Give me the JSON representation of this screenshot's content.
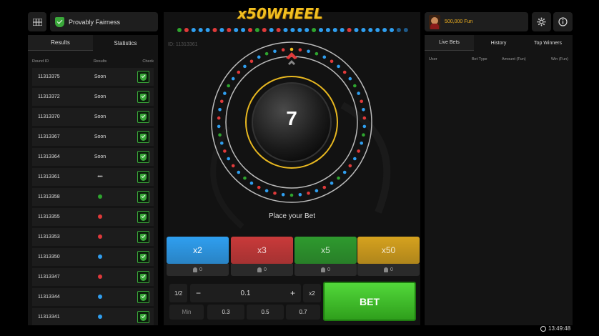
{
  "header": {
    "provably_fairness": "Provably Fairness",
    "logo_text": "x50WHEEL",
    "balance": "500,000 Fun"
  },
  "left": {
    "tabs": [
      "Results",
      "Statistics"
    ],
    "columns": [
      "Round ID",
      "Results",
      "Check"
    ],
    "rows": [
      {
        "id": "11313375",
        "result": "Soon",
        "color": ""
      },
      {
        "id": "11313372",
        "result": "Soon",
        "color": ""
      },
      {
        "id": "11313370",
        "result": "Soon",
        "color": ""
      },
      {
        "id": "11313367",
        "result": "Soon",
        "color": ""
      },
      {
        "id": "11313364",
        "result": "Soon",
        "color": ""
      },
      {
        "id": "11313361",
        "result": "•••",
        "color": ""
      },
      {
        "id": "11313358",
        "result": "",
        "color": "#2ea52e"
      },
      {
        "id": "11313355",
        "result": "",
        "color": "#e03a3a"
      },
      {
        "id": "11313353",
        "result": "",
        "color": "#e03a3a"
      },
      {
        "id": "11313350",
        "result": "",
        "color": "#2f9ff0"
      },
      {
        "id": "11313347",
        "result": "",
        "color": "#e03a3a"
      },
      {
        "id": "11313344",
        "result": "",
        "color": "#2f9ff0"
      },
      {
        "id": "11313341",
        "result": "",
        "color": "#2f9ff0"
      }
    ]
  },
  "center": {
    "round_id": "ID: 11313361",
    "countdown": "7",
    "place_bet": "Place your Bet",
    "history_colors": [
      "#2ea52e",
      "#e03a3a",
      "#2f9ff0",
      "#2f9ff0",
      "#2f9ff0",
      "#e03a3a",
      "#2f9ff0",
      "#e03a3a",
      "#2f9ff0",
      "#2f9ff0",
      "#e03a3a",
      "#2ea52e",
      "#e03a3a",
      "#2f9ff0",
      "#e03a3a",
      "#2f9ff0",
      "#2f9ff0",
      "#2f9ff0",
      "#2f9ff0",
      "#2ea52e",
      "#2f9ff0",
      "#2f9ff0",
      "#2f9ff0",
      "#2f9ff0",
      "#e03a3a",
      "#2f9ff0",
      "#2f9ff0",
      "#2f9ff0",
      "#2f9ff0",
      "#2f9ff0",
      "#2f9ff0",
      "#2f9ff0",
      "#2f9ff0"
    ],
    "multipliers": [
      {
        "label": "x2",
        "count": "0",
        "color": "#2f9ff0"
      },
      {
        "label": "x3",
        "count": "0",
        "color": "#c93a3a"
      },
      {
        "label": "x5",
        "count": "0",
        "color": "#2e9a2e"
      },
      {
        "label": "x50",
        "count": "0",
        "color": "#d6a21e"
      }
    ],
    "controls": {
      "half": "1/2",
      "minus": "−",
      "amount": "0.1",
      "plus": "+",
      "double": "x2",
      "presets": [
        "Min",
        "0.3",
        "0.5",
        "0.7"
      ],
      "bet": "BET"
    }
  },
  "right": {
    "tabs": [
      "Live Bets",
      "History",
      "Top Winners"
    ],
    "columns": [
      "User",
      "Bet Type",
      "Amount (Fun)",
      "Win (Fun)"
    ]
  },
  "footer": {
    "time": "13:49:48"
  },
  "icons": [
    "grid-icon",
    "shield-icon",
    "gear-icon",
    "info-icon",
    "clock-icon",
    "arrow-up-icon",
    "user-icon"
  ]
}
